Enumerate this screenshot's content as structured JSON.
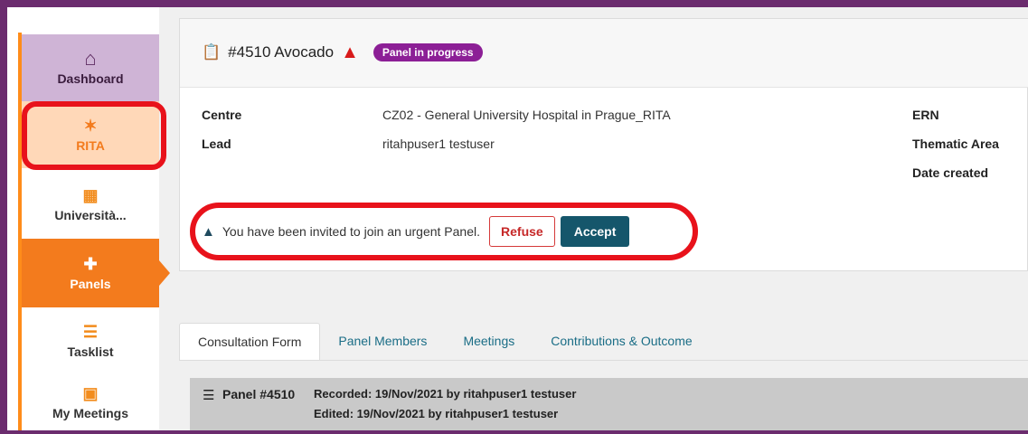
{
  "sidebar": {
    "items": [
      {
        "label": "Dashboard",
        "icon": "home-icon"
      },
      {
        "label": "RITA",
        "icon": "network-icon"
      },
      {
        "label": "Università...",
        "icon": "building-icon"
      },
      {
        "label": "Panels",
        "icon": "clipboard-plus-icon"
      },
      {
        "label": "Tasklist",
        "icon": "checklist-icon"
      },
      {
        "label": "My Meetings",
        "icon": "calendar-icon"
      }
    ]
  },
  "panel": {
    "title": "#4510 Avocado",
    "status": "Panel in progress",
    "centre_label": "Centre",
    "centre_value": "CZ02 - General University Hospital in Prague_RITA",
    "lead_label": "Lead",
    "lead_value": "ritahpuser1 testuser",
    "ern_label": "ERN",
    "thematic_label": "Thematic Area",
    "date_label": "Date created"
  },
  "invite": {
    "message": "You have been invited to join an urgent Panel.",
    "refuse": "Refuse",
    "accept": "Accept"
  },
  "tabs": [
    {
      "label": "Consultation Form"
    },
    {
      "label": "Panel Members"
    },
    {
      "label": "Meetings"
    },
    {
      "label": "Contributions & Outcome"
    }
  ],
  "record": {
    "title": "Panel #4510",
    "recorded": "Recorded: 19/Nov/2021 by ritahpuser1 testuser",
    "edited": "Edited: 19/Nov/2021 by ritahpuser1 testuser"
  },
  "colors": {
    "frame": "#6b2c6e",
    "accent": "#f37b1d",
    "badge": "#8c1f96",
    "accept": "#15566b",
    "highlight": "#e8121b"
  }
}
